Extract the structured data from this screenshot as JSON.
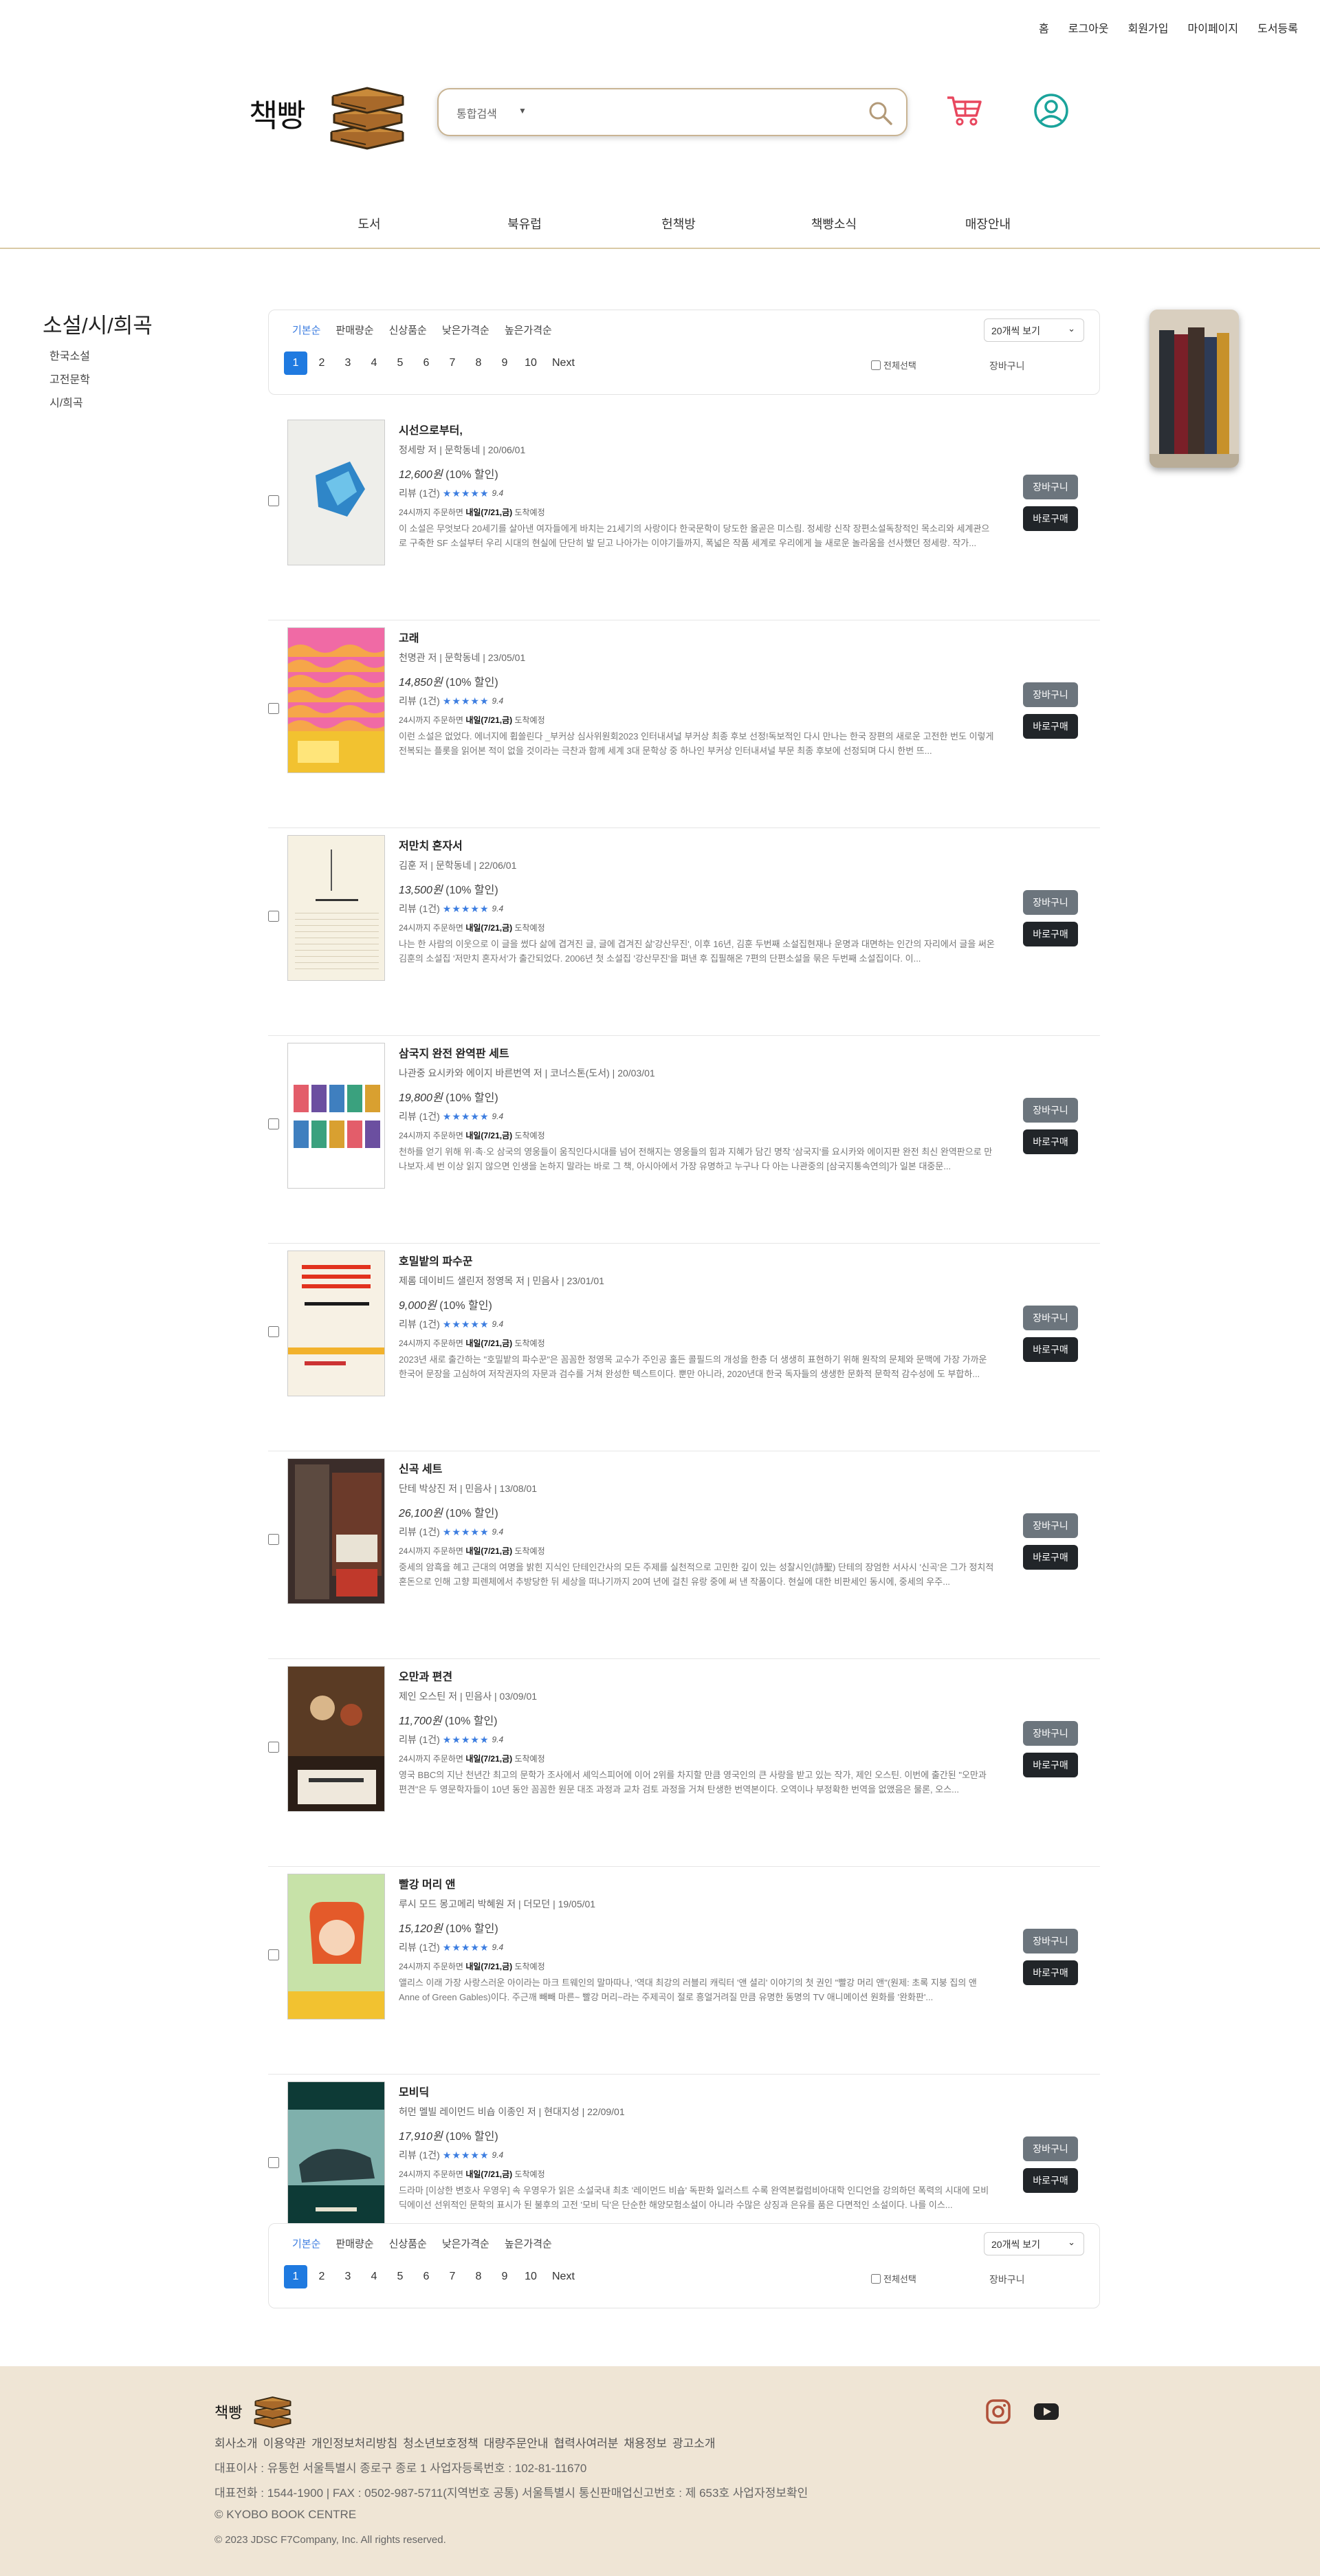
{
  "topnav": [
    "홈",
    "로그아웃",
    "회원가입",
    "마이페이지",
    "도서등록"
  ],
  "logo_text": "책빵",
  "search": {
    "select": "통합검색",
    "placeholder": ""
  },
  "catnav": [
    "도서",
    "북유럽",
    "헌책방",
    "책빵소식",
    "매장안내"
  ],
  "sidebar": {
    "title": "소설/시/희곡",
    "items": [
      "한국소설",
      "고전문학",
      "시/희곡"
    ]
  },
  "toolbar": {
    "sorts": [
      "기본순",
      "판매량순",
      "신상품순",
      "낮은가격순",
      "높은가격순"
    ],
    "per_page": "20개씩 보기",
    "pages": [
      "1",
      "2",
      "3",
      "4",
      "5",
      "6",
      "7",
      "8",
      "9",
      "10"
    ],
    "next": "Next",
    "select_all": "전체선택",
    "cart": "장바구니"
  },
  "labels": {
    "review": "리뷰",
    "rating": "9.4",
    "cart_btn": "장바구니",
    "buy_btn": "바로구매"
  },
  "books": [
    {
      "title": "시선으로부터,",
      "meta": "정세랑 저 | 문학동네 | 20/06/01",
      "price": "12,600원",
      "discount": "(10% 할인)",
      "reviews": "(1건)",
      "ship_pre": "24시까지 주문하면",
      "ship_date": "내일(7/21,금)",
      "ship_post": "도착예정",
      "desc": "이 소설은 무엇보다 20세기를 살아낸 여자들에게 바치는 21세기의 사랑이다 한국문학이 당도한 올곧은 미스림. 정세랑 신작 장편소설독창적인 목소리와 세계관으로 구축한 SF 소설부터 우리 시대의 현실에 단단히 발 딛고 나아가는 이야기들까지, 폭넓은 작품 세계로 우리에게 늘 새로운 놀라움을 선사했던 정세랑. 작가...",
      "cover": "blue"
    },
    {
      "title": "고래",
      "meta": "천명관 저 | 문학동네 | 23/05/01",
      "price": "14,850원",
      "discount": "(10% 할인)",
      "reviews": "(1건)",
      "ship_pre": "24시까지 주문하면",
      "ship_date": "내일(7/21,금)",
      "ship_post": "도착예정",
      "desc": "이런 소설은 없었다. 에너지에 휩쓸린다 _부커상 심사위원회2023 인터내셔널 부커상 최종 후보 선정!독보적인 다시 만나는 한국 장편의 새로운 고전한 번도 이렇게 전복되는 플롯을 읽어본 적이 없을 것이라는 극찬과 함께 세계 3대 문학상 중 하나인 부커상 인터내셔널 부문 최종 후보에 선정되며 다시 한번 뜨...",
      "cover": "pink"
    },
    {
      "title": "저만치 혼자서",
      "meta": "김훈 저 | 문학동네 | 22/06/01",
      "price": "13,500원",
      "discount": "(10% 할인)",
      "reviews": "(1건)",
      "ship_pre": "24시까지 주문하면",
      "ship_date": "내일(7/21,금)",
      "ship_post": "도착예정",
      "desc": "나는 한 사람의 이웃으로 이 글을 썼다 삶에 겹겨진 글, 글에 겹겨진 삶'강산무진', 이후 16년, 김훈 두번째 소설집현재나 운명과 대면하는 인간의 자리에서 글을 써온 김훈의 소설집 '저만치 혼자서'가 출간되었다. 2006년 첫 소설집 '강산무진'을 펴낸 후 집필해온 7편의 단편소설을 묶은 두번째 소설집이다. 이...",
      "cover": "cream"
    },
    {
      "title": "삼국지 완전 완역판 세트",
      "meta": "나관중 요시카와 에이지 바른번역 저 | 코너스톤(도서) | 20/03/01",
      "price": "19,800원",
      "discount": "(10% 할인)",
      "reviews": "(1건)",
      "ship_pre": "24시까지 주문하면",
      "ship_date": "내일(7/21,금)",
      "ship_post": "도착예정",
      "desc": "천하를 얻기 위해 위·촉·오 삼국의 영웅들이 움직인다시대를 넘어 전해지는 영웅들의 힘과 지혜가 담긴 명작 '삼국지'를 요시카와 에이지판 완전 최신 완역판으로 만나보자.세 번 이상 읽지 않으면 인생을 논하지 말라는 바로 그 책, 아시아에서 가장 유명하고 누구나 다 아는 나관중의 [삼국지통속연의]가 일본 대중문...",
      "cover": "sets"
    },
    {
      "title": "호밀밭의 파수꾼",
      "meta": "제롬 데이비드 샐린저 정영목 저 | 민음사 | 23/01/01",
      "price": "9,000원",
      "discount": "(10% 할인)",
      "reviews": "(1건)",
      "ship_pre": "24시까지 주문하면",
      "ship_date": "내일(7/21,금)",
      "ship_post": "도착예정",
      "desc": "2023년 새로 출간하는 \"호밀밭의 파수꾼\"은 꼼꼼한 정영목 교수가 주인공 홀든 콜필드의 개성을 한층 더 생생히 표현하기 위해 원작의 문체와 문맥에 가장 가까운 한국어 문장을 고심하여 저작권자의 자문과 검수를 거쳐 완성한 텍스트이다. 뿐만 아니라, 2020년대 한국 독자들의 생생한 문화적 문학적 감수성에 도 부합하...",
      "cover": "catcher"
    },
    {
      "title": "신곡 세트",
      "meta": "단테 박상진 저 | 민음사 | 13/08/01",
      "price": "26,100원",
      "discount": "(10% 할인)",
      "reviews": "(1건)",
      "ship_pre": "24시까지 주문하면",
      "ship_date": "내일(7/21,금)",
      "ship_post": "도착예정",
      "desc": "중세의 암흑을 헤고 근대의 여명을 밝힌 지식인 단테인간사의 모든 주제를 실천적으로 고민한 깊이 있는 성찰시인(詩聖) 단테의 장엄한 서사시 '신곡'은 그가 정치적 혼돈으로 인해 고향 피렌체에서 추방당한 뒤 세상을 떠나기까지 20여 년에 걸친 유랑 중에 써 낸 작품이다. 현실에 대한 비판세인 동시에, 중세의 우주...",
      "cover": "dante"
    },
    {
      "title": "오만과 편견",
      "meta": "제인 오스틴 저 | 민음사 | 03/09/01",
      "price": "11,700원",
      "discount": "(10% 할인)",
      "reviews": "(1건)",
      "ship_pre": "24시까지 주문하면",
      "ship_date": "내일(7/21,금)",
      "ship_post": "도착예정",
      "desc": "영국 BBC의 지난 천년간 최고의 문학가 조사에서 셰익스피어에 이어 2위를 차지할 만큼 영국인의 큰 사랑을 받고 있는 작가, 제인 오스틴. 이번에 출간된 \"오만과 편견\"은 두 영문학자들이 10년 동안 꼼꼼한 원문 대조 과정과 교차 검토 과정을 거쳐 탄생한 번역본이다. 오역이나 부정확한 번역을 없앴음은 물론, 오스...",
      "cover": "pride"
    },
    {
      "title": "빨강 머리 앤",
      "meta": "루시 모드 몽고메리 박혜원 저 | 더모던 | 19/05/01",
      "price": "15,120원",
      "discount": "(10% 할인)",
      "reviews": "(1건)",
      "ship_pre": "24시까지 주문하면",
      "ship_date": "내일(7/21,금)",
      "ship_post": "도착예정",
      "desc": "앨리스 이래 가장 사랑스러운 아이라는 마크 트웨인의 말마따나, '역대 최강의 러블리 캐릭터 '앤 셜리' 이야기의 첫 권인 \"빨강 머리 앤\"(원제: 초록 지붕 집의 앤 Anne of Green Gables)이다. 주근깨 빼빼 마른~ 빨강 머리~라는 주제곡이 절로 흥얼거려질 만큼 유명한 동명의 TV 애니메이션 원화를 '완화판'...",
      "cover": "anne"
    },
    {
      "title": "모비딕",
      "meta": "허먼 멜빌 레이먼드 비숍 이종인 저 | 현대지성 | 22/09/01",
      "price": "17,910원",
      "discount": "(10% 할인)",
      "reviews": "(1건)",
      "ship_pre": "24시까지 주문하면",
      "ship_date": "내일(7/21,금)",
      "ship_post": "도착예정",
      "desc": "드라마 [이상한 변호사 우영우] 속 우영우가 읽은 소설국내 최초 '레이먼드 비숍' 독판화 일러스트 수록 완역본컬럼비아대학 인디언을 강의하던 폭력의 시대에 모비딕에이선 선위적인 문학의 표시가 된 불후의 고전 '모비 딕'은 단순한 해양모험소설이 아니라 수많은 상징과 은유를 품은 다면적인 소설이다. 나를 이스...",
      "cover": "moby"
    }
  ],
  "footer": {
    "links": [
      "회사소개",
      "이용약관",
      "개인정보처리방침",
      "청소년보호정책",
      "대량주문안내",
      "협력사여러분",
      "채용정보",
      "광고소개"
    ],
    "line1": "대표이사 : 유통헌 서울특별시 종로구 종로 1 사업자등록번호 : 102-81-11670",
    "line2": "대표전화 : 1544-1900 | FAX : 0502-987-5711(지역번호 공통) 서울특별시 통신판매업신고번호 : 제 653호 사업자정보확인",
    "line3": "© KYOBO BOOK CENTRE",
    "line4": "© 2023 JDSC F7Company, Inc. All rights reserved."
  },
  "colors": {
    "accent": "#1f7ae0",
    "stars": "#3c7de0",
    "cart_btn": "#6c757d",
    "buy_btn": "#212529",
    "footer_bg": "#efe5d5",
    "cart_icon": "#e8475e",
    "user_icon": "#1aa39b"
  },
  "icons": [
    "search-icon",
    "cart-icon",
    "user-icon",
    "instagram-icon",
    "youtube-icon"
  ]
}
